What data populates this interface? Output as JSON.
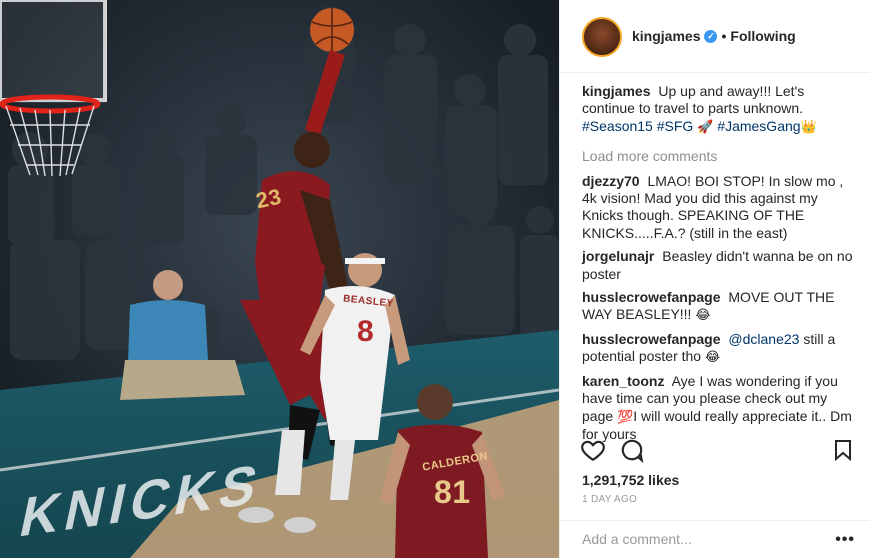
{
  "post": {
    "username": "kingjames",
    "verified_badge": "✓",
    "separator": "•",
    "follow_state": "Following"
  },
  "caption": {
    "user": "kingjames",
    "text": "Up up and away!!! Let's continue to travel to parts unknown.",
    "tag1": "#Season15",
    "tag2": "#SFG",
    "emoji1": "🚀",
    "tag3": "#JamesGang",
    "emoji2": "👑"
  },
  "load_more": "Load more comments",
  "comments": [
    {
      "user": "djezzy70",
      "text": "LMAO! BOI STOP! In slow mo , 4k vision! Mad you did this against my Knicks though. SPEAKING OF THE KNICKS.....F.A.? (still in the east)"
    },
    {
      "user": "jorgelunajr",
      "text": "Beasley didn't wanna be on no poster"
    },
    {
      "user": "husslecrowefanpage",
      "text": "MOVE OUT THE WAY BEASLEY!!!",
      "emoji": "😂"
    },
    {
      "user": "husslecrowefanpage",
      "mention": "@dclane23",
      "text": "still a potential poster tho",
      "emoji": "😂"
    },
    {
      "user": "karen_toonz",
      "text_before": "Aye I was wondering if you have time can you please check out my page",
      "emoji": "💯",
      "text_after": "I will would really appreciate it.. Dm for yours"
    }
  ],
  "actions": {
    "like_icon": "heart-icon",
    "comment_icon": "comment-bubble-icon",
    "save_icon": "bookmark-icon"
  },
  "likes": "1,291,752 likes",
  "time_ago": "1 DAY AGO",
  "comment_input": {
    "placeholder": "Add a comment..."
  },
  "more_label": "•••",
  "photo": {
    "jersey_back_name": "CALDERON",
    "jersey_back_number": "81",
    "jersey_front_number": "23",
    "defender_name": "BEASLEY",
    "defender_number": "8",
    "court_text": "KNICKS"
  }
}
